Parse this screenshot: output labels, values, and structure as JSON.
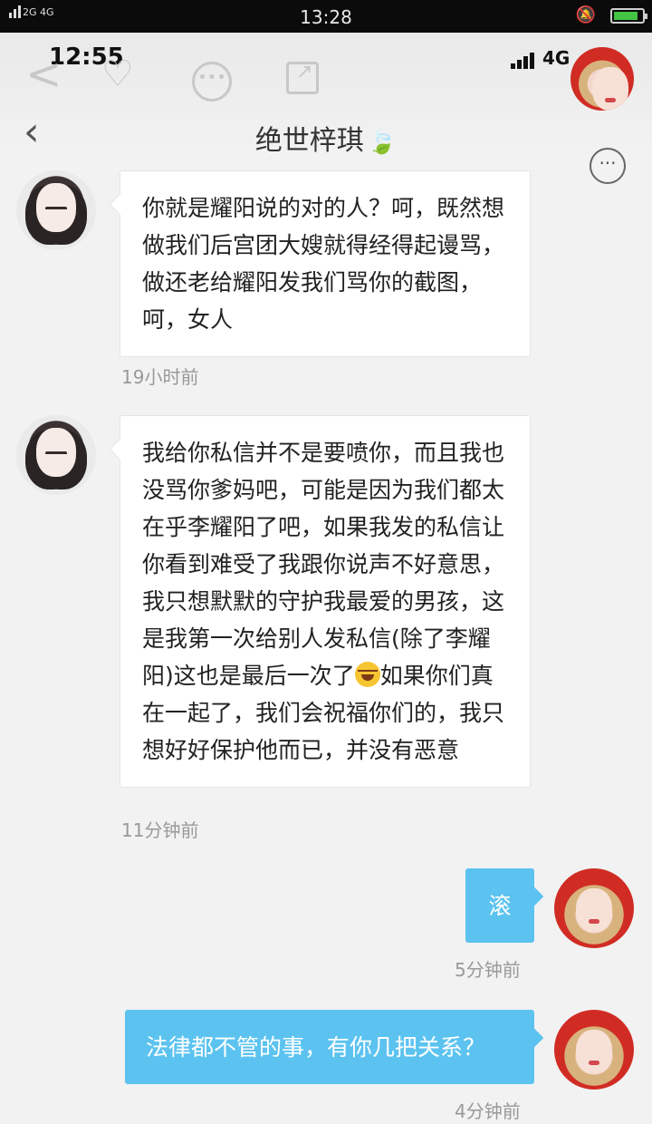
{
  "outer_status": {
    "network": "2G 4G",
    "time": "13:28"
  },
  "inner_status": {
    "time": "12:55",
    "network": "4G"
  },
  "header": {
    "title": "绝世梓琪",
    "title_icon": "leaf-emoji"
  },
  "messages": [
    {
      "side": "incoming",
      "text": "你就是耀阳说的对的人？呵，既然想做我们后宫团大嫂就得经得起谩骂，做还老给耀阳发我们骂你的截图，呵，女人",
      "time": "19小时前"
    },
    {
      "side": "incoming",
      "text_before_emoji": "我给你私信并不是要喷你，而且我也没骂你爹妈吧，可能是因为我们都太在乎李耀阳了吧，如果我发的私信让你看到难受了我跟你说声不好意思，我只想默默的守护我最爱的男孩，这是我第一次给别人发私信(除了李耀阳)这也是最后一次了",
      "emoji": "tears-of-joy-emoji",
      "text_after_emoji": "如果你们真在一起了，我们会祝福你们的，我只想好好保护他而已，并没有恶意",
      "time": "11分钟前"
    },
    {
      "side": "outgoing",
      "text": "滚",
      "time": "5分钟前"
    },
    {
      "side": "outgoing",
      "text": "法律都不管的事，有你几把关系？",
      "time": "4分钟前"
    }
  ],
  "colors": {
    "outgoing_bubble": "#5cc3f0",
    "incoming_bubble": "#ffffff",
    "background": "#f2f2f2"
  }
}
